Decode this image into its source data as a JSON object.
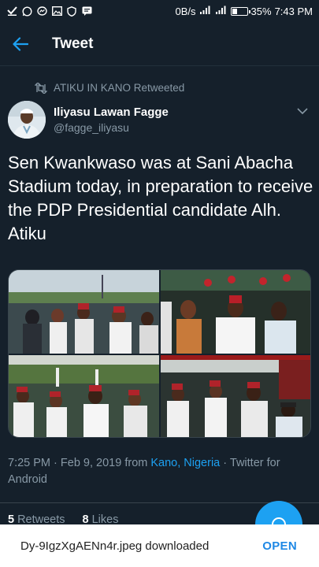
{
  "status_bar": {
    "data_rate": "0B/s",
    "battery_percent": "35%",
    "battery_level": 0.35,
    "time": "7:43 PM",
    "icons": [
      "check-download-icon",
      "whatsapp-icon",
      "messenger-icon",
      "gallery-icon",
      "shield-icon",
      "chat-icon"
    ]
  },
  "header": {
    "title": "Tweet"
  },
  "tweet": {
    "retweet_label": "ATIKU IN KANO Retweeted",
    "author_name": "Iliyasu Lawan Fagge",
    "author_handle": "@fagge_iliyasu",
    "text": "Sen Kwankwaso was at Sani Abacha Stadium today, in preparation to receive the PDP Presidential candidate Alh. Atiku",
    "photos": [
      "stadium-crowd-photo-1",
      "stadium-crowd-photo-2",
      "stadium-crowd-photo-3",
      "stadium-crowd-photo-4"
    ],
    "meta": {
      "time": "7:25 PM",
      "separator": "·",
      "date": "Feb 9, 2019",
      "from_word": "from",
      "location": "Kano, Nigeria",
      "source": "Twitter for Android"
    },
    "retweets_count": "5",
    "retweets_label": "Retweets",
    "likes_count": "8",
    "likes_label": "Likes"
  },
  "download_bar": {
    "filename_text": "Dy-9IgzXgAENn4r.jpeg downloaded",
    "action": "OPEN"
  },
  "colors": {
    "background": "#15202b",
    "accent": "#1da1f2",
    "secondary_text": "#8899a6"
  }
}
